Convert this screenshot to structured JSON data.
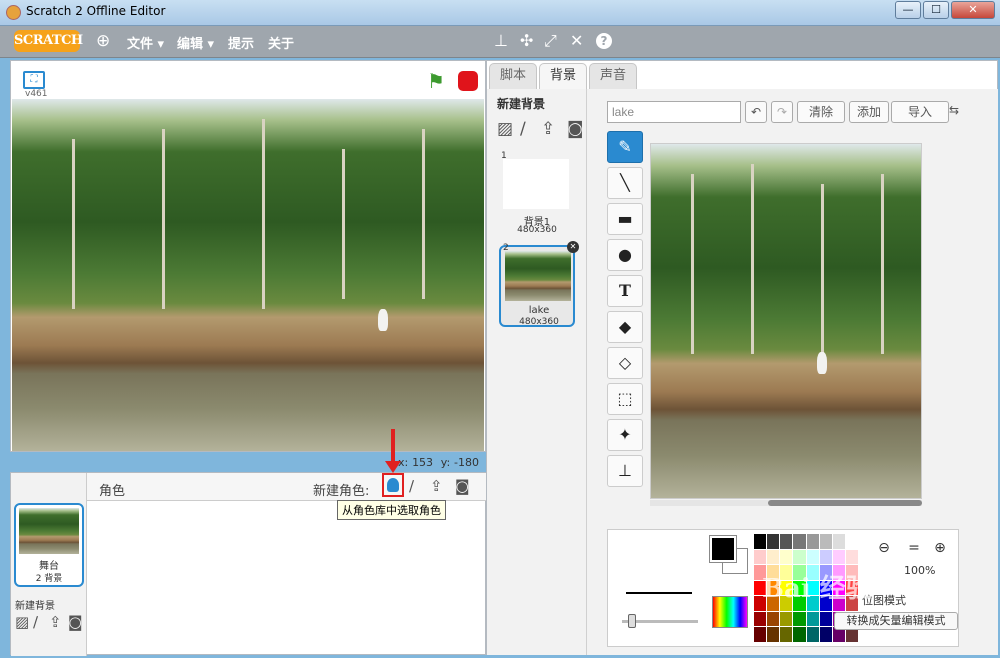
{
  "window": {
    "title": "Scratch 2 Offline Editor",
    "min": "—",
    "max": "☐",
    "close": "✕"
  },
  "menubar": {
    "logo": "SCRATCH",
    "items": [
      "文件 ▾",
      "编辑 ▾",
      "提示",
      "关于"
    ],
    "tools": [
      "copy-stamp-icon",
      "cut-scissors-icon",
      "grow-icon",
      "shrink-icon",
      "help-icon"
    ]
  },
  "stage": {
    "version": "v461",
    "coords_x_label": "x:",
    "coords_x": "153",
    "coords_y_label": "y:",
    "coords_y": "-180"
  },
  "sprites": {
    "header": "角色",
    "new_sprite_label": "新建角色:",
    "tooltip": "从角色库中选取角色",
    "stage_label": "舞台",
    "stage_count": "2 背景",
    "new_backdrop": "新建背景"
  },
  "tabs": [
    "脚本",
    "背景",
    "声音"
  ],
  "backdrops": {
    "title": "新建背景",
    "items": [
      {
        "num": "1",
        "name": "背景1",
        "size": "480x360"
      },
      {
        "num": "2",
        "name": "lake",
        "size": "480x360"
      }
    ]
  },
  "editor": {
    "name_value": "lake",
    "clear": "清除",
    "add": "添加",
    "import": "导入",
    "zoom_pct": "100%",
    "mode1": "位图模式",
    "mode2": "转换成矢量编辑模式"
  },
  "colors": {
    "accent": "#2a8ad0",
    "stop": "#e0141b",
    "flag": "#3d9a2f",
    "highlight": "#e02020"
  },
  "watermark": "Bai 经验"
}
